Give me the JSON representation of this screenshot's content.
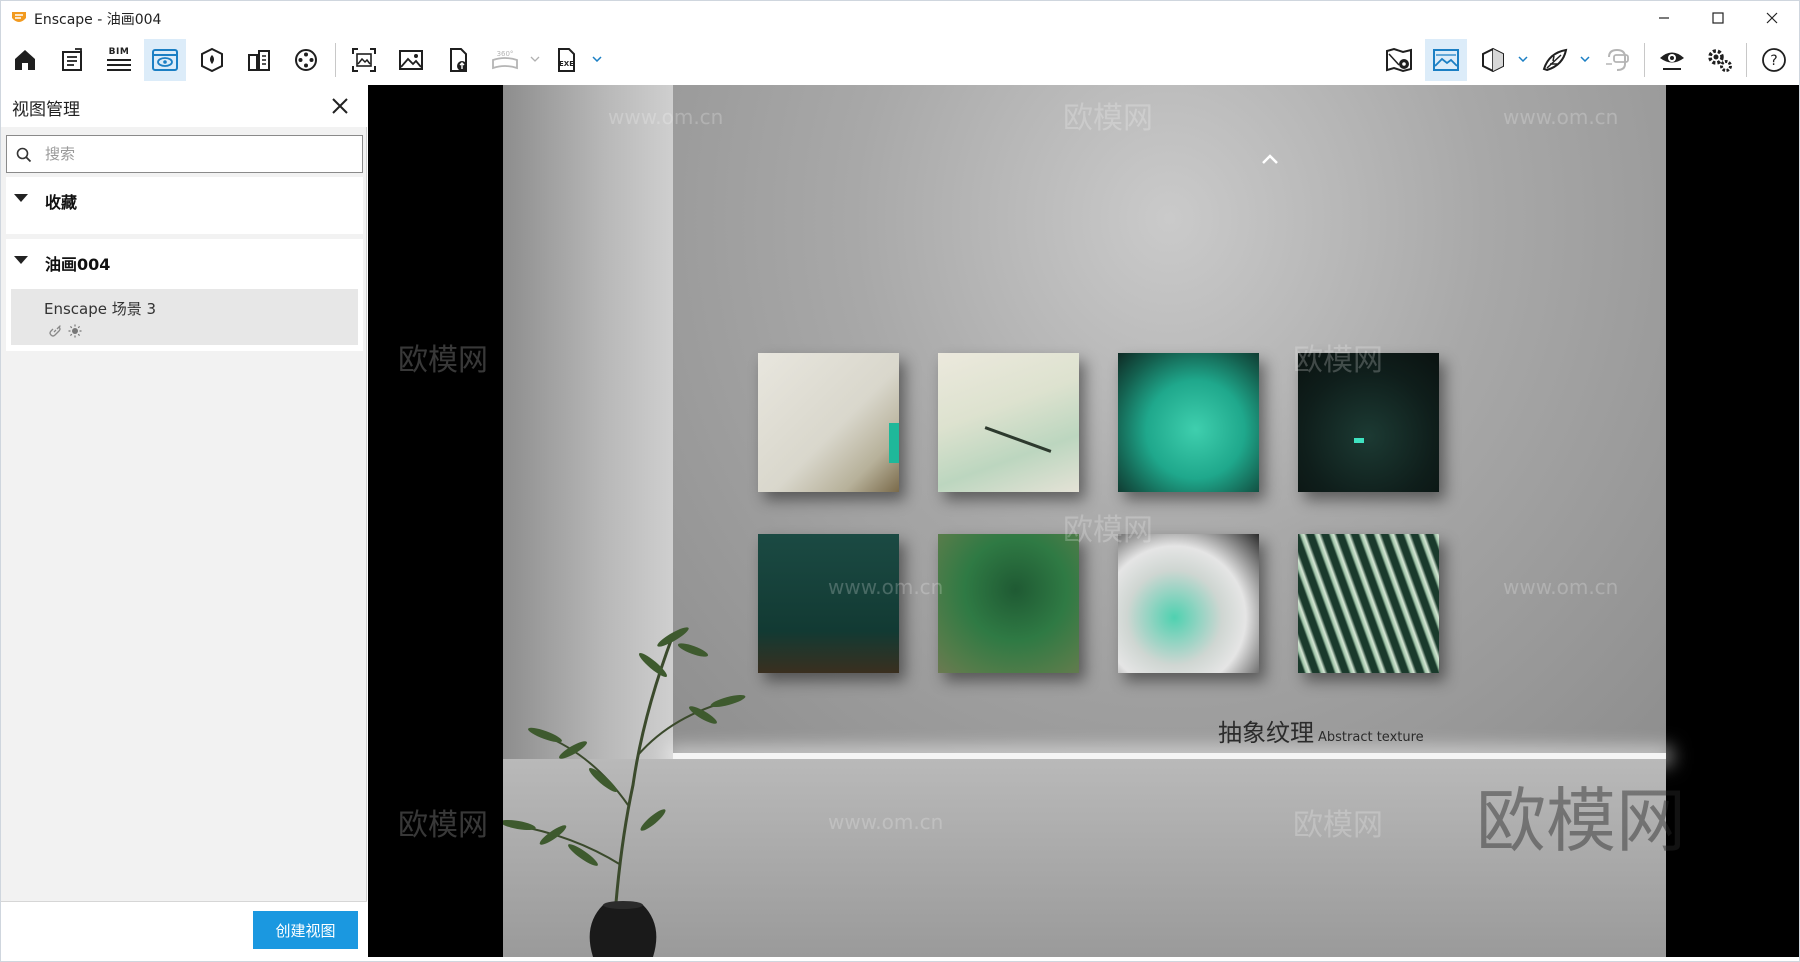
{
  "window": {
    "title": "Enscape - 油画004"
  },
  "toolbar": {
    "bim_label": "BIM",
    "icons": [
      "home-icon",
      "project-notes-icon",
      "bim-icon",
      "view-management-icon",
      "site-context-icon",
      "asset-library-icon",
      "video-editor-icon",
      "batch-render-icon",
      "screenshot-icon",
      "upload-icon",
      "panorama-icon",
      "exe-export-icon",
      "map-icon",
      "visual-settings-icon",
      "section-icon",
      "atmosphere-icon",
      "vr-headset-icon",
      "eye-icon",
      "settings-icon",
      "help-icon"
    ]
  },
  "sidebar": {
    "title": "视图管理",
    "search": {
      "placeholder": "搜索",
      "value": ""
    },
    "groups": [
      {
        "label": "收藏",
        "items": []
      },
      {
        "label": "油画004",
        "items": [
          {
            "label": "Enscape 场景 3"
          }
        ]
      }
    ],
    "create_button": "创建视图"
  },
  "viewport": {
    "caption_cn": "抽象纹理",
    "caption_en": "Abstract texture",
    "watermark_cn": "欧模网",
    "watermark_url": "www.om.cn"
  },
  "colors": {
    "accent": "#1b98e0",
    "active_tool_bg": "#dcecf9"
  }
}
